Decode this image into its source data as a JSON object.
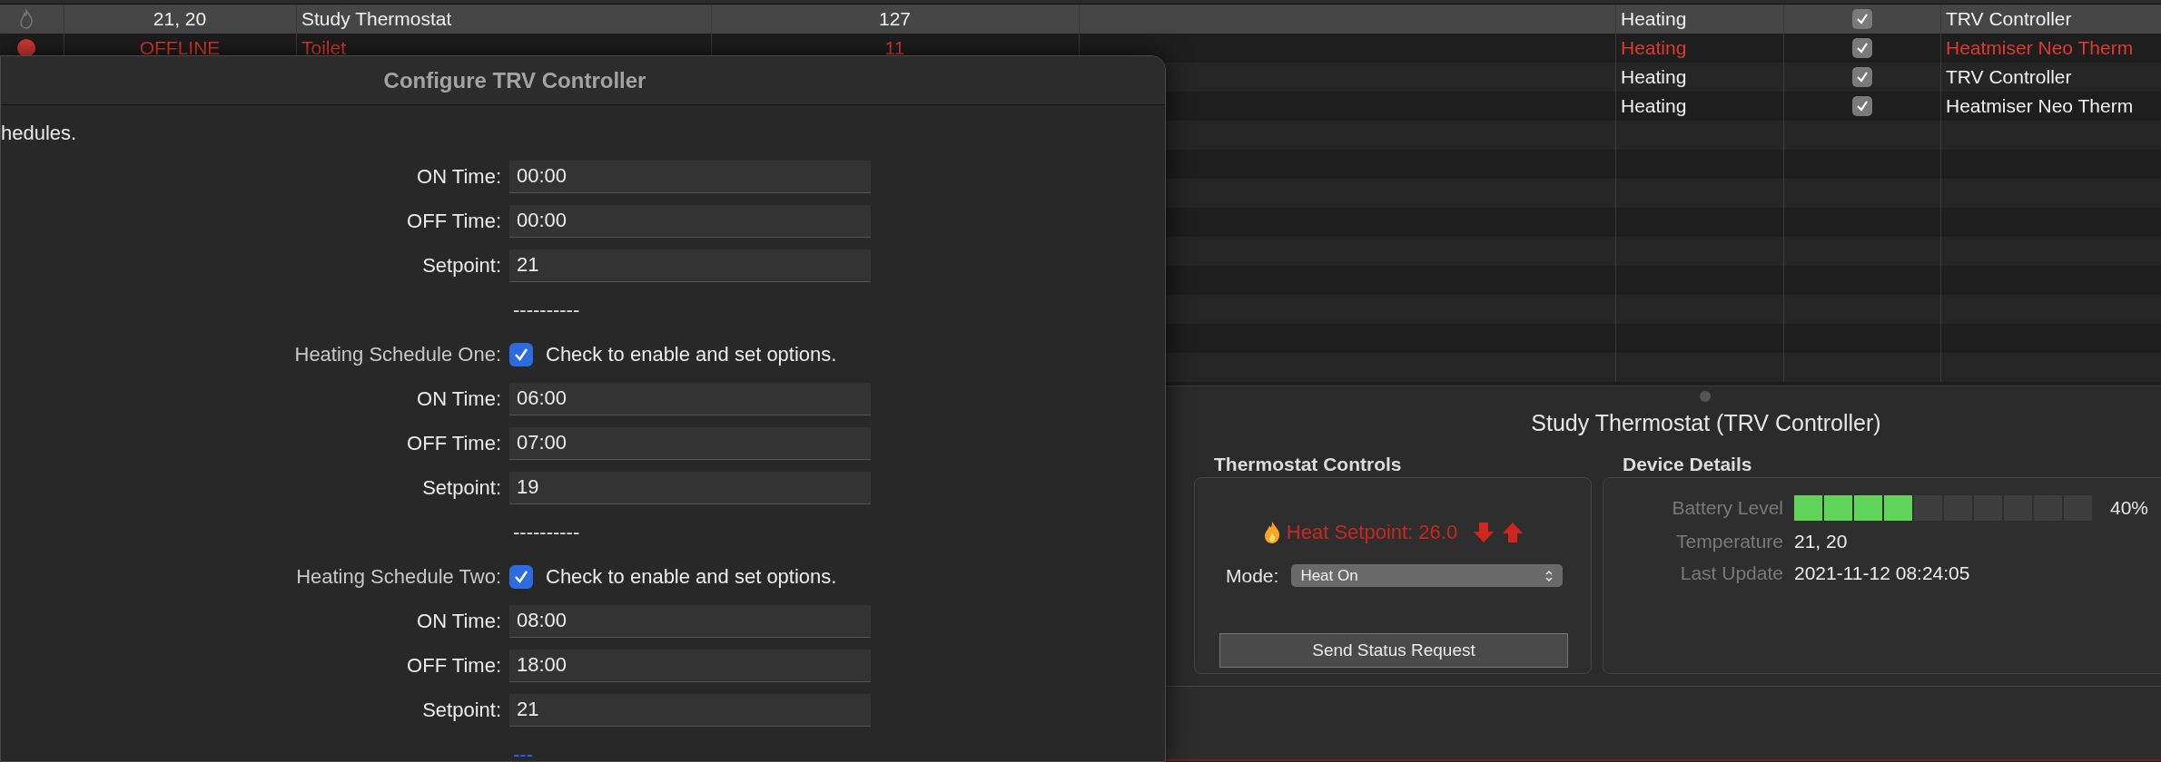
{
  "table": {
    "rows": [
      {
        "kind": "idle",
        "temperature": "21, 20",
        "name": "Study Thermostat",
        "column_4": "127",
        "mode": "Heating",
        "checked": true,
        "type": "TRV Controller",
        "selected": true,
        "offline": false
      },
      {
        "kind": "offline",
        "temperature": "OFFLINE",
        "name": "Toilet",
        "column_4": "11",
        "mode": "Heating",
        "checked": true,
        "type": "Heatmiser Neo Therm",
        "selected": false,
        "offline": true
      },
      {
        "mode": "Heating",
        "checked": true,
        "type": "TRV Controller",
        "selected": false,
        "offline": false
      },
      {
        "mode": "Heating",
        "checked": true,
        "type": "Heatmiser Neo Therm",
        "selected": false,
        "offline": false
      }
    ]
  },
  "dialog": {
    "title": "Configure TRV Controller",
    "description": "hedules.",
    "rows": [
      {
        "kind": "field",
        "label": "ON Time:",
        "value": "00:00"
      },
      {
        "kind": "field",
        "label": "OFF Time:",
        "value": "00:00"
      },
      {
        "kind": "field",
        "label": "Setpoint:",
        "value": "21"
      },
      {
        "kind": "separator",
        "text": "----------"
      },
      {
        "kind": "checkbox",
        "label": "Heating Schedule One:",
        "text": "Check to enable and set options.",
        "checked": true
      },
      {
        "kind": "field",
        "label": "ON Time:",
        "value": "06:00"
      },
      {
        "kind": "field",
        "label": "OFF Time:",
        "value": "07:00"
      },
      {
        "kind": "field",
        "label": "Setpoint:",
        "value": "19"
      },
      {
        "kind": "separator",
        "text": "----------"
      },
      {
        "kind": "checkbox",
        "label": "Heating Schedule Two:",
        "text": "Check to enable and set options.",
        "checked": true
      },
      {
        "kind": "field",
        "label": "ON Time:",
        "value": "08:00"
      },
      {
        "kind": "field",
        "label": "OFF Time:",
        "value": "18:00"
      },
      {
        "kind": "field",
        "label": "Setpoint:",
        "value": "21"
      },
      {
        "kind": "link",
        "text": "---"
      }
    ]
  },
  "detail": {
    "title": "Study Thermostat (TRV Controller)",
    "controls": {
      "heading": "Thermostat Controls",
      "setpoint": "Heat Setpoint: 26.0",
      "mode_label": "Mode:",
      "mode": "Heat On",
      "button": "Send Status Request"
    },
    "details": {
      "heading": "Device Details",
      "battery_label": "Battery Level",
      "battery": {
        "level": 0.4
      },
      "battery_reading": "40%",
      "rows": [
        {
          "label": "Temperature",
          "value": "21, 20"
        },
        {
          "label": "Last Update",
          "value": "2021-11-12 08:24:05"
        }
      ]
    }
  }
}
